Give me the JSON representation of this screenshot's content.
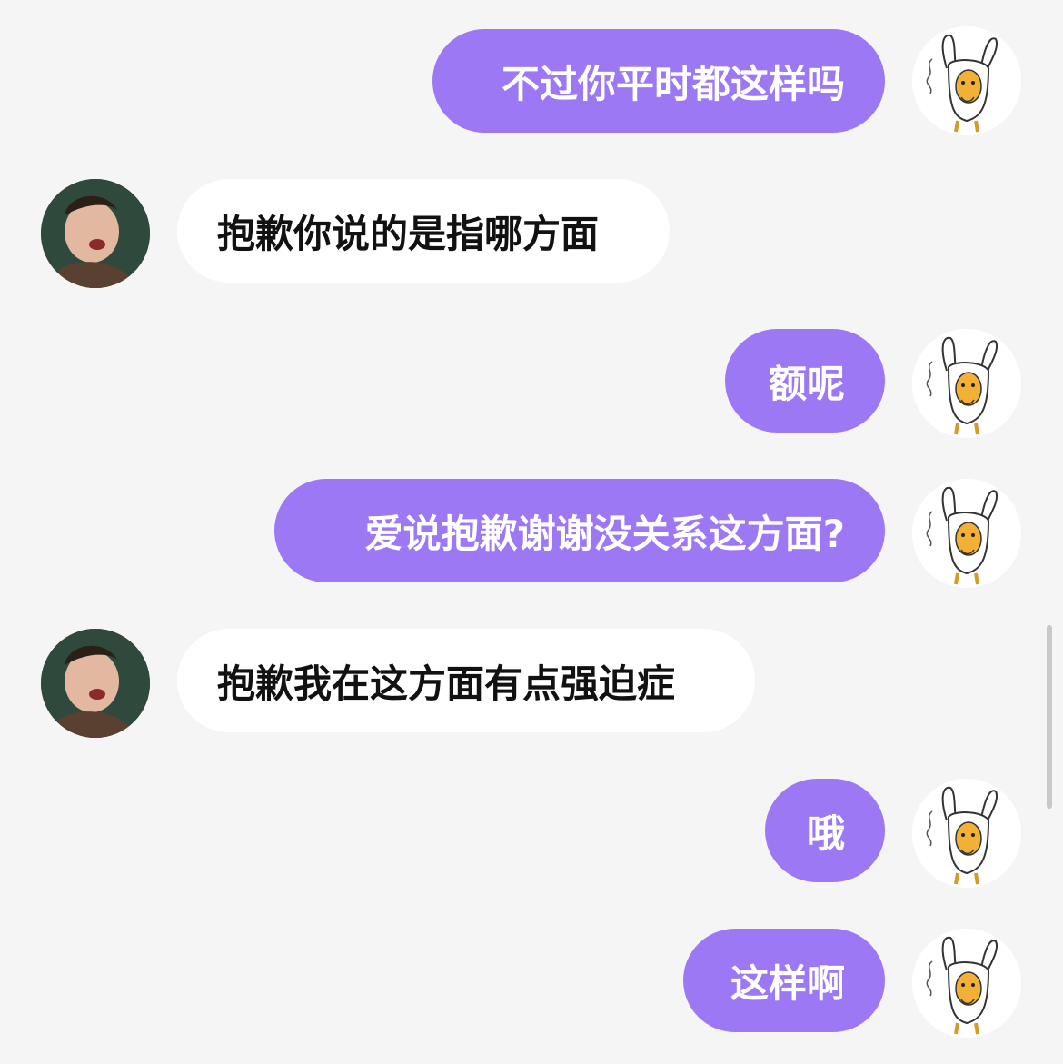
{
  "chat": {
    "messages": [
      {
        "side": "out",
        "text": "不过你平时都这样吗"
      },
      {
        "side": "in",
        "text": "抱歉你说的是指哪方面"
      },
      {
        "side": "out",
        "text": "额呢"
      },
      {
        "side": "out",
        "text": "爱说抱歉谢谢没关系这方面?"
      },
      {
        "side": "in",
        "text": "抱歉我在这方面有点强迫症"
      },
      {
        "side": "out",
        "text": "哦"
      },
      {
        "side": "out",
        "text": "这样啊"
      }
    ]
  },
  "avatars": {
    "me": "bunny-costume-cartoon-avatar",
    "them": "person-photo-avatar"
  },
  "colors": {
    "outgoing_bubble": "#9c78f5",
    "incoming_bubble": "#ffffff",
    "background": "#f5f5f5"
  }
}
